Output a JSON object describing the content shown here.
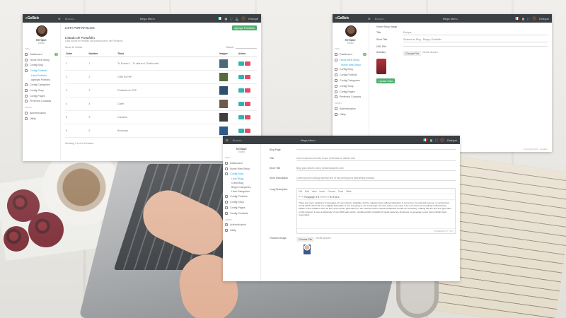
{
  "app": {
    "brand_prefix": "e",
    "brand_rest": "GeBeb",
    "search_placeholder": "Buscar...",
    "website_menu": "Mega Menu",
    "user": "Enrique",
    "role": "Editor"
  },
  "nav": {
    "section_main": "MAIN",
    "section_admin": "ADMIN",
    "items": [
      {
        "label": "Dashboard",
        "badge": "3"
      },
      {
        "label": "Home Web Setup"
      },
      {
        "label": "Config Blog"
      },
      {
        "label": "Config Portfolio"
      },
      {
        "label": "Config Categories"
      },
      {
        "label": "Config Shop"
      },
      {
        "label": "Config Pages"
      },
      {
        "label": "Preferred Contacts"
      },
      {
        "label": "Authentication"
      },
      {
        "label": "Utility"
      }
    ],
    "portfolio_subitems": [
      "Lista Portfolio",
      "Agregar Portfolio"
    ],
    "blog_subitems": [
      "Lista Blogs",
      "Crear Blog",
      "Blogs Categories",
      "Lista Categories"
    ],
    "extra_items": [
      "Config Portfolio",
      "Config Shop",
      "Config Pages",
      "Config Contacts"
    ]
  },
  "window1": {
    "card_title": "LISTA PORTAFOLIOS",
    "add_button": "Agregar Portafolio",
    "page_title": "Listado de Portafolio",
    "page_sub": "Lista donde se reflejan las publicaciones del Portafolio",
    "show_label": "Show 10 entries",
    "search_label": "Search:",
    "headers": [
      "Order",
      "Number",
      "Titulo",
      "Imagen",
      "Action"
    ],
    "rows": [
      {
        "order": "1",
        "number": "1",
        "title": "Tu Evento 1 - Tu vida en 1 Diseño web",
        "color": "#4a6a7a"
      },
      {
        "order": "2",
        "number": "2",
        "title": "CRM en PHP",
        "color": "#556b3b"
      },
      {
        "order": "3",
        "number": "3",
        "title": "Portafolio en PHP",
        "color": "#2f4f6f"
      },
      {
        "order": "4",
        "number": "4",
        "title": "Cartel",
        "color": "#6b5d4a"
      },
      {
        "order": "5",
        "number": "5",
        "title": "Contacto",
        "color": "#3e3e3e"
      },
      {
        "order": "6",
        "number": "6",
        "title": "Bootstrap",
        "color": "#2d5b8a"
      }
    ],
    "showing": "Showing 1 to 6 of 6 entries",
    "page": "1"
  },
  "window2": {
    "f1_label": "Home Setup Image",
    "f1_value": "Enrique",
    "f2_label": "Short Title",
    "f2_value": "Sistema de Blog - Blogs y Portafolio",
    "f3_label": "URL Title",
    "f3_value": "",
    "f4_label": "Subtitulo",
    "f4_value": "",
    "upload_buttons": [
      "Choose File",
      "No file chosen"
    ],
    "update_button": "Update Data",
    "footer": "Copyright 2024 - eGeBeb"
  },
  "window3": {
    "rows": [
      {
        "label": "Blog Page",
        "value": ""
      },
      {
        "label": "Title",
        "value": "Una revolución de todo lo que necesitas en diseño web"
      },
      {
        "label": "Short Title",
        "value": "Blog para diseño web y desarrolladores web"
      },
      {
        "label": "Short Description",
        "value": "Lorem ipsum is simply dummy text of the printing and typesetting industry."
      }
    ],
    "long_desc_label": "Long Description",
    "editor_menu": [
      "File",
      "Edit",
      "View",
      "Insert",
      "Format",
      "Tools",
      "Table"
    ],
    "editor_tools": "↶  ↷  Paragraph  ▾  B  I  ≡  ≡  ≡  ≡  ☰  ☰  ⧉  ⧉",
    "editor_text": "There are many variations of passages of Lorem Ipsum available, but the majority have suffered alteration in some form, by injected humour, or randomised words which don't look even slightly believable. If you are going to use a passage of Lorem Ipsum, you need to be sure there isn't anything embarrassing hidden in the middle of text. All the Lorem Ipsum generators on the Internet tend to repeat predefined chunks as necessary, making this the first true generator on the Internet. It uses a dictionary of over 200 Latin words, combined with a handful of model sentence structures, to generate Lorem Ipsum which looks reasonable.",
    "editor_footer": "POWERED BY TINY",
    "featured_label": "Featured Image",
    "upload_buttons": [
      "Choose File",
      "No file chosen"
    ]
  }
}
